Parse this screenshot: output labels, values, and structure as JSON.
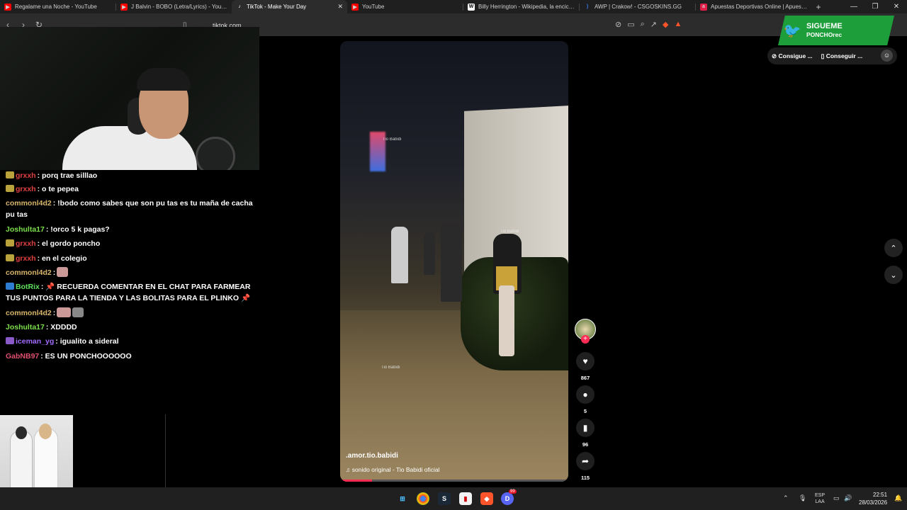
{
  "browser": {
    "tabs": [
      {
        "title": "Regalame una Noche - YouTube",
        "icon": "youtube-icon",
        "color": "#ff0000"
      },
      {
        "title": "J Balvin - BOBO (Letra/Lyrics) - YouTube",
        "icon": "youtube-icon",
        "color": "#ff0000"
      },
      {
        "title": "TikTok - Make Your Day",
        "icon": "tiktok-icon",
        "color": "#ffffff"
      },
      {
        "title": "YouTube",
        "icon": "youtube-icon",
        "color": "#ff0000"
      },
      {
        "title": "Billy Herrington - Wikipedia, la enciclopedia",
        "icon": "wikipedia-icon",
        "color": "#ffffff"
      },
      {
        "title": "AWP | Crakow! - CSGOSKINS.GG",
        "icon": "csgoskins-icon",
        "color": "#3b82f6"
      },
      {
        "title": "Apuestas Deportivas Online | Apuestas",
        "icon": "betting-icon",
        "color": "#e11d48"
      }
    ],
    "url": "tiktok.com"
  },
  "chat": {
    "messages": [
      {
        "user": "grxxh",
        "text": ": porq trae silllao",
        "color": "#e0413f"
      },
      {
        "user": "grxxh",
        "text": ": o te pepea",
        "color": "#e0413f"
      },
      {
        "user": "commonl4d2",
        "text": ": !bodo como sabes que son pu tas es tu maña de cacha pu tas",
        "color": "#d9b56a"
      },
      {
        "user": "Joshulta17",
        "text": ": !orco 5 k pagas?",
        "color": "#7be04a"
      },
      {
        "user": "grxxh",
        "text": ": el gordo poncho",
        "color": "#e0413f"
      },
      {
        "user": "grxxh",
        "text": ": en el colegio",
        "color": "#e0413f"
      },
      {
        "user": "commonl4d2",
        "text": ":",
        "color": "#d9b56a"
      },
      {
        "user": "BotRix",
        "text": ": 📌 RECUERDA COMENTAR EN EL CHAT PARA FARMEAR TUS PUNTOS PARA LA TIENDA Y LAS BOLITAS PARA EL PLINKO 📌",
        "color": "#5ee05e"
      },
      {
        "user": "commonl4d2",
        "text": ":",
        "color": "#d9b56a"
      },
      {
        "user": "Joshulta17",
        "text": ": XDDDD",
        "color": "#7be04a"
      },
      {
        "user": "iceman_yg",
        "text": ": igualito a sideral",
        "color": "#a16bff"
      },
      {
        "user": "GabNB97",
        "text": ": ES UN PONCHOOOOOO",
        "color": "#e05070"
      }
    ]
  },
  "video": {
    "username": ".amor.tio.babidi",
    "sound": "sonido original - Tio Babidi oficial",
    "watermark": "Tio Babidi",
    "progress": 0.14
  },
  "actions": {
    "likes": "867",
    "comments": "5",
    "saves": "96",
    "shares": "115"
  },
  "promo": {
    "line1": "SIGUEME",
    "line2": "PONCHOrec"
  },
  "pills": {
    "first": "Consigue ...",
    "second": "Conseguir ..."
  },
  "taskbar": {
    "lang1": "ESP",
    "lang2": "LAA",
    "time": "22:51",
    "date": "28/03/2026",
    "discord_badge": "99"
  },
  "colors": {
    "accent": "#fe2c55",
    "taskbar": "#202020",
    "promo": "#1e9e3a"
  }
}
